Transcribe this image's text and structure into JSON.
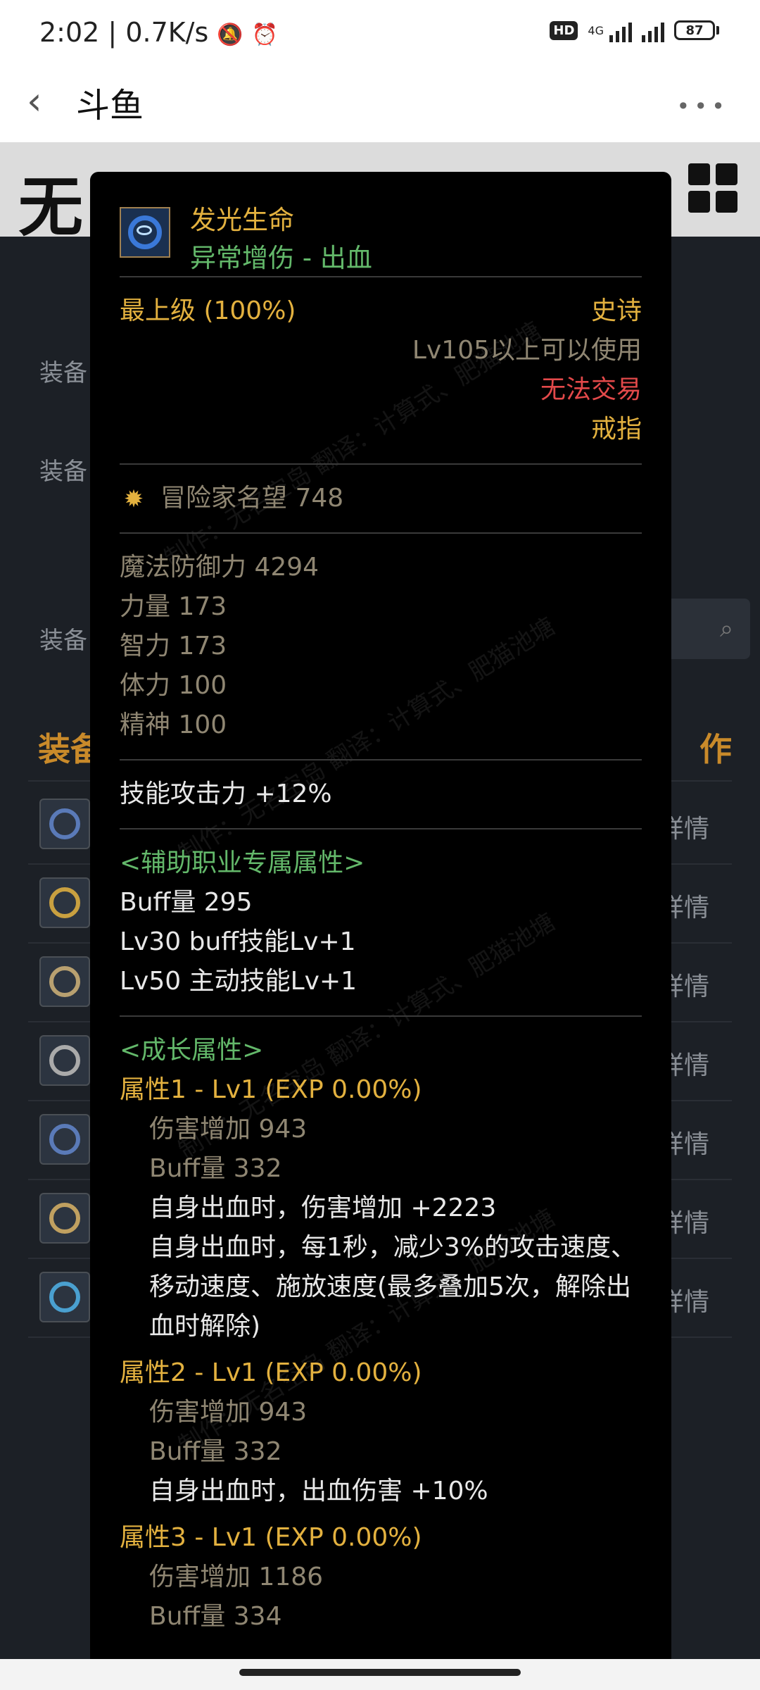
{
  "status_bar": {
    "time": "2:02",
    "speed": "0.7K/s",
    "hd": "HD",
    "network": "4G",
    "battery": "87"
  },
  "app_bar": {
    "title": "斗鱼"
  },
  "background_page": {
    "labels": [
      "装备",
      "装备",
      "装备"
    ],
    "heading_left": "装备",
    "heading_right": "作",
    "row_detail": "详情"
  },
  "tooltip": {
    "name": "发光生命",
    "subtitle": "异常增伤 - 出血",
    "grade": "最上级 (100%)",
    "rarity": "史诗",
    "level_req": "Lv105以上可以使用",
    "trade": "无法交易",
    "slot": "戒指",
    "fame": "冒险家名望 748",
    "base_stats": [
      "魔法防御力   4294",
      "力量   173",
      "智力   173",
      "体力   100",
      "精神   100"
    ],
    "skill_attack": "技能攻击力   +12%",
    "support_header": "<辅助职业专属属性>",
    "support_lines": [
      "Buff量   295",
      "Lv30 buff技能Lv+1",
      "Lv50 主动技能Lv+1"
    ],
    "growth_header": "<成长属性>",
    "attr1_title": "属性1 - Lv1 (EXP 0.00%)",
    "attr1_grey": [
      "伤害增加   943",
      "Buff量   332"
    ],
    "attr1_white": [
      "自身出血时，伤害增加 +2223",
      "自身出血时，每1秒，减少3%的攻击速度、移动速度、施放速度(最多叠加5次，解除出血时解除)"
    ],
    "attr2_title": "属性2 - Lv1 (EXP 0.00%)",
    "attr2_grey": [
      "伤害增加   943",
      "Buff量   332"
    ],
    "attr2_white": [
      "自身出血时，出血伤害 +10%"
    ],
    "attr3_title": "属性3 - Lv1 (EXP 0.00%)",
    "attr3_grey": [
      "伤害增加   1186",
      "Buff量   334"
    ],
    "watermark": "制作：无名空岛 翻译：计算式、肥猫池塘"
  },
  "colors": {
    "gold": "#e3b13f",
    "green": "#63b86a",
    "red": "#e2494a",
    "grey": "#8f8672",
    "tooltip_bg": "#000000",
    "page_bg": "#1c2026"
  }
}
